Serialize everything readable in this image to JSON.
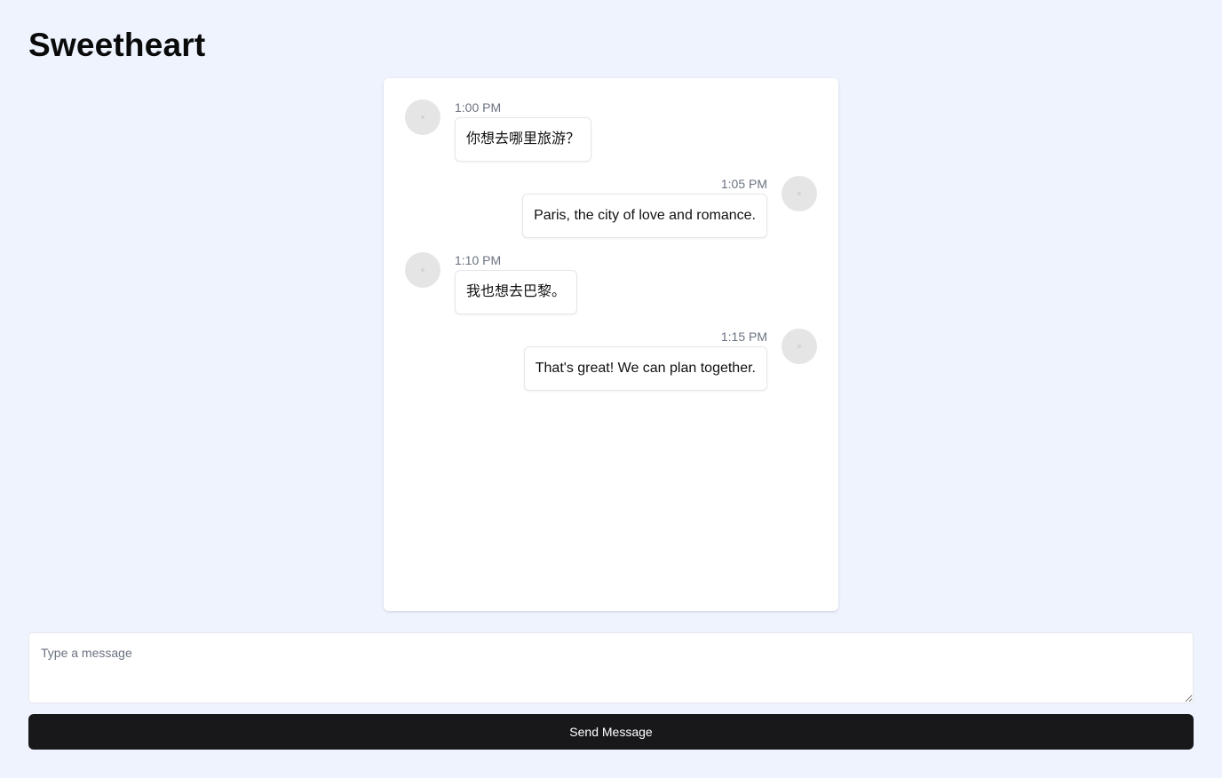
{
  "header": {
    "title": "Sweetheart"
  },
  "messages": [
    {
      "time": "1:00 PM",
      "text": "你想去哪里旅游？",
      "side": "left"
    },
    {
      "time": "1:05 PM",
      "text": "Paris, the city of love and romance.",
      "side": "right"
    },
    {
      "time": "1:10 PM",
      "text": "我也想去巴黎。",
      "side": "left"
    },
    {
      "time": "1:15 PM",
      "text": "That's great! We can plan together.",
      "side": "right"
    }
  ],
  "composer": {
    "placeholder": "Type a message",
    "value": ""
  },
  "actions": {
    "send_label": "Send Message"
  }
}
